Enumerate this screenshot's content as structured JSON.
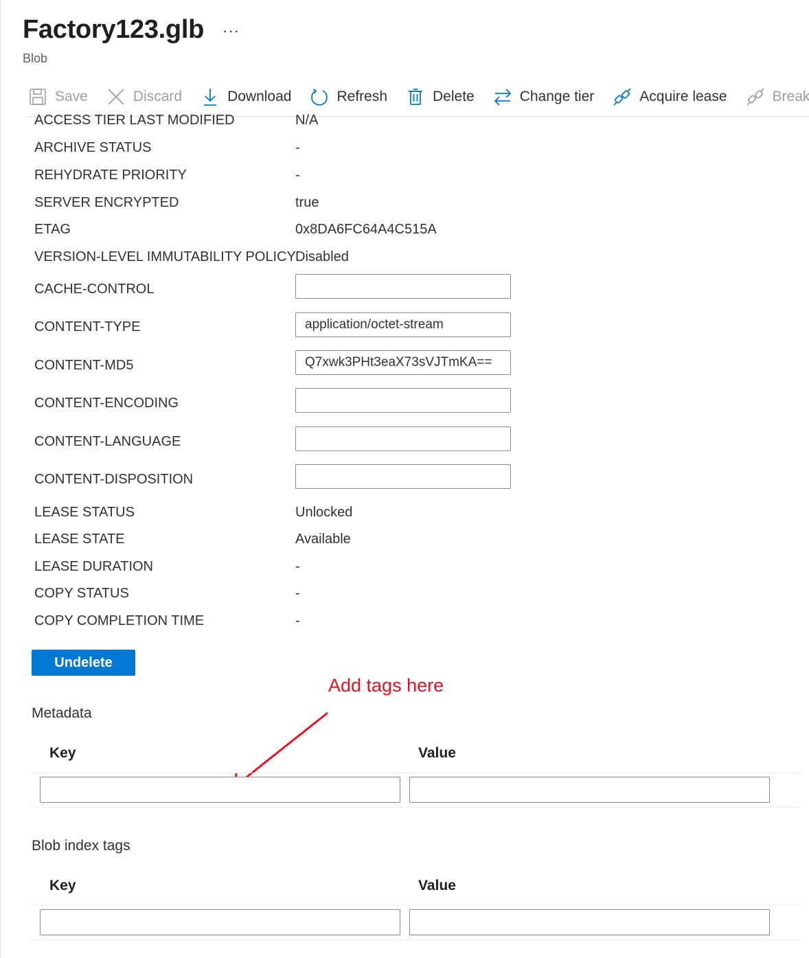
{
  "header": {
    "title": "Factory123.glb",
    "more": "···",
    "subtitle": "Blob"
  },
  "toolbar": {
    "save": "Save",
    "discard": "Discard",
    "download": "Download",
    "refresh": "Refresh",
    "delete": "Delete",
    "change_tier": "Change tier",
    "acquire_lease": "Acquire lease",
    "break_lease": "Break lease"
  },
  "properties": [
    {
      "key": "ACCESS TIER LAST MODIFIED",
      "value": "N/A"
    },
    {
      "key": "ARCHIVE STATUS",
      "value": "-"
    },
    {
      "key": "REHYDRATE PRIORITY",
      "value": "-"
    },
    {
      "key": "SERVER ENCRYPTED",
      "value": "true"
    },
    {
      "key": "ETAG",
      "value": "0x8DA6FC64A4C515A"
    },
    {
      "key": "VERSION-LEVEL IMMUTABILITY POLICY",
      "value": "Disabled"
    }
  ],
  "editable": [
    {
      "key": "CACHE-CONTROL",
      "value": ""
    },
    {
      "key": "CONTENT-TYPE",
      "value": "application/octet-stream"
    },
    {
      "key": "CONTENT-MD5",
      "value": "Q7xwk3PHt3eaX73sVJTmKA=="
    },
    {
      "key": "CONTENT-ENCODING",
      "value": ""
    },
    {
      "key": "CONTENT-LANGUAGE",
      "value": ""
    },
    {
      "key": "CONTENT-DISPOSITION",
      "value": ""
    }
  ],
  "lease": [
    {
      "key": "LEASE STATUS",
      "value": "Unlocked"
    },
    {
      "key": "LEASE STATE",
      "value": "Available"
    },
    {
      "key": "LEASE DURATION",
      "value": "-"
    },
    {
      "key": "COPY STATUS",
      "value": "-"
    },
    {
      "key": "COPY COMPLETION TIME",
      "value": "-"
    }
  ],
  "undelete_label": "Undelete",
  "annotation": "Add tags here",
  "metadata": {
    "title": "Metadata",
    "key_header": "Key",
    "value_header": "Value",
    "key_value": "",
    "value_value": ""
  },
  "index_tags": {
    "title": "Blob index tags",
    "key_header": "Key",
    "value_header": "Value",
    "key_value": "",
    "value_value": ""
  },
  "colors": {
    "primary": "#0078d4",
    "annotation": "#e81123",
    "disabled": "#a19f9d"
  }
}
